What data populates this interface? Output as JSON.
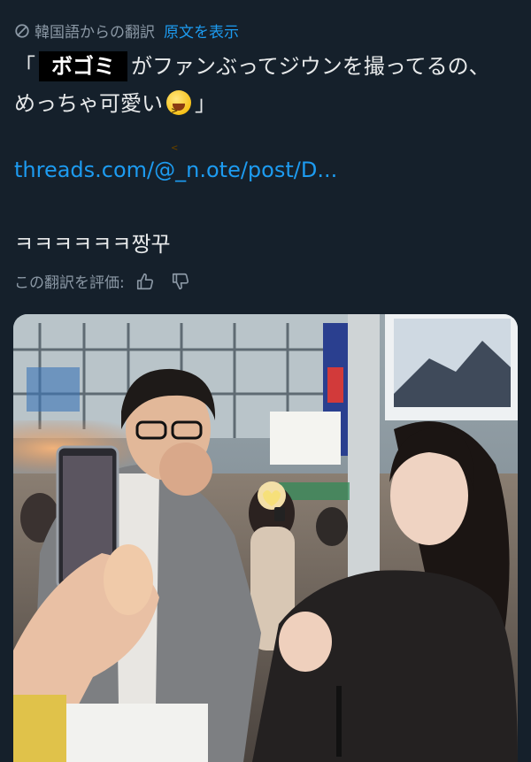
{
  "translation": {
    "label": "韓国語からの翻訳",
    "view_original": "原文を表示"
  },
  "tweet": {
    "open_quote": "「",
    "redacted_name": "ボゴミ",
    "line1_rest": "がファンぶってジウンを撮ってるの、",
    "line2": "めっちゃ可愛い",
    "close_quote": "」",
    "emoji_name": "grinning-squinting-face",
    "link_text": "threads.com/@_n.ote/post/D...",
    "korean_text": "ㅋㅋㅋㅋㅋㅋ짱꾸"
  },
  "rating": {
    "label": "この翻訳を評価:",
    "thumbs_up_icon": "thumbs-up-icon",
    "thumbs_down_icon": "thumbs-down-icon"
  },
  "colors": {
    "background": "#15202b",
    "text": "#e7e9ea",
    "muted": "#8b98a5",
    "link": "#1d9bf0"
  }
}
